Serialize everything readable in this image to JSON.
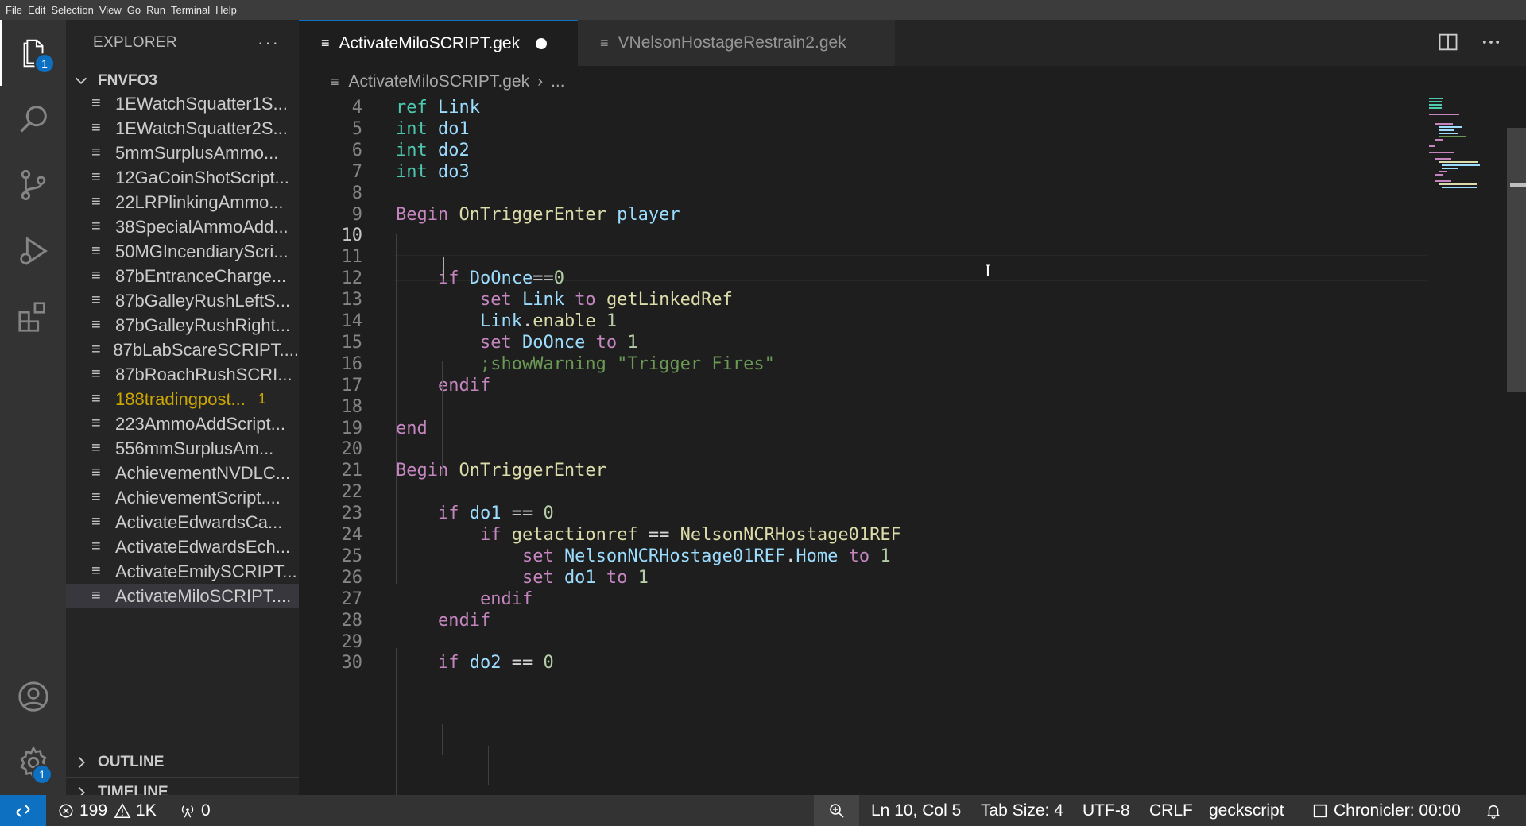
{
  "menu": [
    "File",
    "Edit",
    "Selection",
    "View",
    "Go",
    "Run",
    "Terminal",
    "Help"
  ],
  "activity": {
    "explorer_badge": "1",
    "manage_badge": "1"
  },
  "sidebar": {
    "title": "EXPLORER",
    "more": "···",
    "folder": "FNVFO3",
    "files": [
      {
        "name": "1EWatchSquatter1S...",
        "state": "normal"
      },
      {
        "name": "1EWatchSquatter2S...",
        "state": "normal"
      },
      {
        "name": "5mmSurplusAmmo...",
        "state": "normal"
      },
      {
        "name": "12GaCoinShotScript...",
        "state": "normal"
      },
      {
        "name": "22LRPlinkingAmmo...",
        "state": "normal"
      },
      {
        "name": "38SpecialAmmoAdd...",
        "state": "normal"
      },
      {
        "name": "50MGIncendiaryScri...",
        "state": "normal"
      },
      {
        "name": "87bEntranceCharge...",
        "state": "normal"
      },
      {
        "name": "87bGalleyRushLeftS...",
        "state": "normal"
      },
      {
        "name": "87bGalleyRushRight...",
        "state": "normal"
      },
      {
        "name": "87bLabScareSCRIPT....",
        "state": "normal"
      },
      {
        "name": "87bRoachRushSCRI...",
        "state": "normal"
      },
      {
        "name": "188tradingpost...",
        "state": "warning",
        "count": "1"
      },
      {
        "name": "223AmmoAddScript...",
        "state": "normal"
      },
      {
        "name": "556mmSurplusAm...",
        "state": "normal"
      },
      {
        "name": "AchievementNVDLC...",
        "state": "normal"
      },
      {
        "name": "AchievementScript....",
        "state": "normal"
      },
      {
        "name": "ActivateEdwardsCa...",
        "state": "normal"
      },
      {
        "name": "ActivateEdwardsEch...",
        "state": "normal"
      },
      {
        "name": "ActivateEmilySCRIPT...",
        "state": "normal"
      },
      {
        "name": "ActivateMiloSCRIPT....",
        "state": "selected"
      }
    ],
    "outline": "OUTLINE",
    "timeline": "TIMELINE"
  },
  "tabs": [
    {
      "label": "ActivateMiloSCRIPT.gek",
      "active": true,
      "dirty": true
    },
    {
      "label": "VNelsonHostageRestrain2.gek",
      "active": false,
      "dirty": false
    }
  ],
  "breadcrumb": {
    "file": "ActivateMiloSCRIPT.gek",
    "rest": "..."
  },
  "editor": {
    "current_line": 10,
    "lines": [
      {
        "n": "4",
        "t": [
          [
            "ty",
            "ref "
          ],
          [
            "vr",
            "Link"
          ]
        ]
      },
      {
        "n": "5",
        "t": [
          [
            "ty",
            "int "
          ],
          [
            "vr",
            "do1"
          ]
        ]
      },
      {
        "n": "6",
        "t": [
          [
            "ty",
            "int "
          ],
          [
            "vr",
            "do2"
          ]
        ]
      },
      {
        "n": "7",
        "t": [
          [
            "ty",
            "int "
          ],
          [
            "vr",
            "do3"
          ]
        ]
      },
      {
        "n": "8",
        "t": []
      },
      {
        "n": "9",
        "t": [
          [
            "ctl",
            "Begin "
          ],
          [
            "fn",
            "OnTriggerEnter "
          ],
          [
            "vr",
            "player"
          ]
        ]
      },
      {
        "n": "10",
        "t": []
      },
      {
        "n": "11",
        "t": []
      },
      {
        "n": "12",
        "t": [
          [
            "sp",
            "    "
          ],
          [
            "ctl",
            "if "
          ],
          [
            "vr",
            "DoOnce"
          ],
          [
            "pl",
            "=="
          ],
          [
            "nm",
            "0"
          ]
        ]
      },
      {
        "n": "13",
        "t": [
          [
            "sp",
            "        "
          ],
          [
            "ctl",
            "set "
          ],
          [
            "vr",
            "Link "
          ],
          [
            "ctl",
            "to "
          ],
          [
            "fn",
            "getLinkedRef"
          ]
        ]
      },
      {
        "n": "14",
        "t": [
          [
            "sp",
            "        "
          ],
          [
            "vr",
            "Link"
          ],
          [
            "pl",
            "."
          ],
          [
            "fn",
            "enable "
          ],
          [
            "nm",
            "1"
          ]
        ]
      },
      {
        "n": "15",
        "t": [
          [
            "sp",
            "        "
          ],
          [
            "ctl",
            "set "
          ],
          [
            "vr",
            "DoOnce "
          ],
          [
            "ctl",
            "to "
          ],
          [
            "nm",
            "1"
          ]
        ]
      },
      {
        "n": "16",
        "t": [
          [
            "sp",
            "        "
          ],
          [
            "cm",
            ";showWarning \"Trigger Fires\""
          ]
        ]
      },
      {
        "n": "17",
        "t": [
          [
            "sp",
            "    "
          ],
          [
            "ctl",
            "endif"
          ]
        ]
      },
      {
        "n": "18",
        "t": []
      },
      {
        "n": "19",
        "t": [
          [
            "ctl",
            "end"
          ]
        ]
      },
      {
        "n": "20",
        "t": []
      },
      {
        "n": "21",
        "t": [
          [
            "ctl",
            "Begin "
          ],
          [
            "fn",
            "OnTriggerEnter"
          ]
        ]
      },
      {
        "n": "22",
        "t": []
      },
      {
        "n": "23",
        "t": [
          [
            "sp",
            "    "
          ],
          [
            "ctl",
            "if "
          ],
          [
            "vr",
            "do1 "
          ],
          [
            "pl",
            "== "
          ],
          [
            "nm",
            "0"
          ]
        ]
      },
      {
        "n": "24",
        "t": [
          [
            "sp",
            "        "
          ],
          [
            "ctl",
            "if "
          ],
          [
            "fn",
            "getactionref "
          ],
          [
            "pl",
            "== "
          ],
          [
            "fn",
            "NelsonNCRHostage01REF"
          ]
        ]
      },
      {
        "n": "25",
        "t": [
          [
            "sp",
            "            "
          ],
          [
            "ctl",
            "set "
          ],
          [
            "vr",
            "NelsonNCRHostage01REF"
          ],
          [
            "pl",
            "."
          ],
          [
            "vr",
            "Home "
          ],
          [
            "ctl",
            "to "
          ],
          [
            "nm",
            "1"
          ]
        ]
      },
      {
        "n": "26",
        "t": [
          [
            "sp",
            "            "
          ],
          [
            "ctl",
            "set "
          ],
          [
            "vr",
            "do1 "
          ],
          [
            "ctl",
            "to "
          ],
          [
            "nm",
            "1"
          ]
        ]
      },
      {
        "n": "27",
        "t": [
          [
            "sp",
            "        "
          ],
          [
            "ctl",
            "endif"
          ]
        ]
      },
      {
        "n": "28",
        "t": [
          [
            "sp",
            "    "
          ],
          [
            "ctl",
            "endif"
          ]
        ]
      },
      {
        "n": "29",
        "t": []
      },
      {
        "n": "30",
        "t": [
          [
            "sp",
            "    "
          ],
          [
            "ctl",
            "if "
          ],
          [
            "vr",
            "do2 "
          ],
          [
            "pl",
            "== "
          ],
          [
            "nm",
            "0"
          ]
        ]
      }
    ]
  },
  "status": {
    "errors": "199",
    "warnings": "1K",
    "ports": "0",
    "position": "Ln 10, Col 5",
    "tab_size": "Tab Size: 4",
    "encoding": "UTF-8",
    "eol": "CRLF",
    "language": "geckscript",
    "chronicler": "Chronicler: 00:00"
  },
  "colors": {
    "accent": "#0e70c0",
    "warning": "#cca700",
    "control": "#c586c0",
    "type": "#4ec9b0",
    "variable": "#9cdcfe",
    "function": "#dcdcaa",
    "number": "#b5cea8",
    "comment": "#6a9955"
  }
}
